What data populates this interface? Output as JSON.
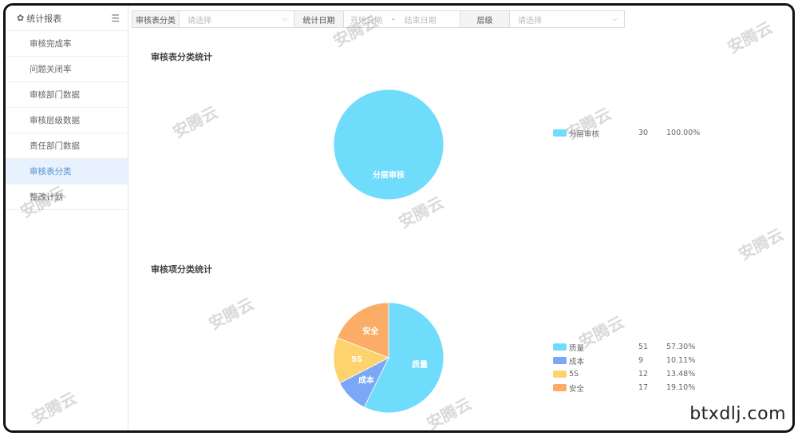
{
  "sidebar": {
    "title": "统计报表",
    "items": [
      {
        "label": "审核完成率",
        "active": false
      },
      {
        "label": "问题关闭率",
        "active": false
      },
      {
        "label": "审核部门数据",
        "active": false
      },
      {
        "label": "审核层级数据",
        "active": false
      },
      {
        "label": "责任部门数据",
        "active": false
      },
      {
        "label": "审核表分类",
        "active": true
      },
      {
        "label": "整改计划",
        "active": false
      }
    ]
  },
  "filters": {
    "category_label": "审核表分类",
    "category_placeholder": "请选择",
    "date_label": "统计日期",
    "date_start_placeholder": "开始日期",
    "date_end_placeholder": "结束日期",
    "date_separator": "-",
    "level_label": "层级",
    "level_placeholder": "请选择"
  },
  "chart_data": [
    {
      "type": "pie",
      "title": "审核表分类统计",
      "series": [
        {
          "name": "分层审核",
          "value": 30,
          "percent": "100.00%",
          "color": "#6fdcfc"
        }
      ]
    },
    {
      "type": "pie",
      "title": "审核项分类统计",
      "series": [
        {
          "name": "质量",
          "value": 51,
          "percent": "57.30%",
          "color": "#6fdcfc"
        },
        {
          "name": "成本",
          "value": 9,
          "percent": "10.11%",
          "color": "#7aa8f6"
        },
        {
          "name": "5S",
          "value": 12,
          "percent": "13.48%",
          "color": "#fcd36d"
        },
        {
          "name": "安全",
          "value": 17,
          "percent": "19.10%",
          "color": "#fbad68"
        }
      ]
    }
  ],
  "watermark_text": "安腾云",
  "site_label": "btxdlj.com"
}
